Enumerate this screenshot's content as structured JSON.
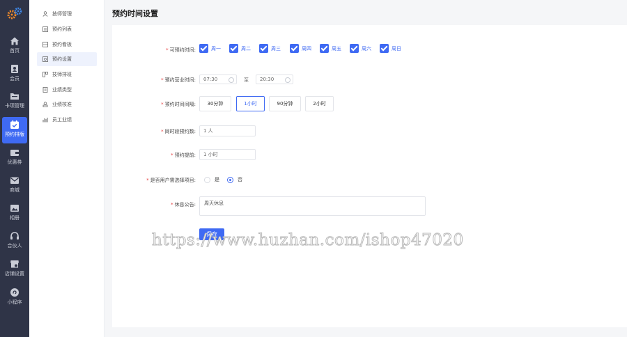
{
  "app": {
    "accent": "#3f6af3",
    "rail_bg": "#2f3447",
    "required_color": "#e63a3a"
  },
  "rail": {
    "items": [
      {
        "label": "首页",
        "icon": "home-icon"
      },
      {
        "label": "会员",
        "icon": "member-icon"
      },
      {
        "label": "卡项管理",
        "icon": "folder-icon"
      },
      {
        "label": "预约排版",
        "icon": "calendar-icon"
      },
      {
        "label": "优惠券",
        "icon": "wallet-icon"
      },
      {
        "label": "商城",
        "icon": "mail-icon"
      },
      {
        "label": "相册",
        "icon": "gallery-icon"
      },
      {
        "label": "合伙人",
        "icon": "headset-icon"
      },
      {
        "label": "店铺设置",
        "icon": "store-icon"
      },
      {
        "label": "小程序",
        "icon": "miniprogram-icon"
      }
    ],
    "active_index": 3
  },
  "submenu": {
    "items": [
      {
        "label": "技师管理",
        "icon": "user-icon"
      },
      {
        "label": "预约列表",
        "icon": "list-icon"
      },
      {
        "label": "预约看板",
        "icon": "board-icon"
      },
      {
        "label": "预约设置",
        "icon": "settings-icon"
      },
      {
        "label": "技师排班",
        "icon": "schedule-icon"
      },
      {
        "label": "业绩类型",
        "icon": "doc-icon"
      },
      {
        "label": "业绩核准",
        "icon": "approve-icon"
      },
      {
        "label": "员工业绩",
        "icon": "chart-icon"
      }
    ],
    "active_index": 3
  },
  "page": {
    "title": "预约时间设置"
  },
  "form": {
    "weekdays_label": "可预约时间:",
    "weekdays": [
      "周一",
      "周二",
      "周三",
      "周四",
      "周五",
      "周六",
      "周日"
    ],
    "hours_label": "预约营业时间:",
    "start_time": "07:30",
    "to_label": "至",
    "end_time": "20:30",
    "interval_label": "预约时间间隔:",
    "intervals": [
      "30分钟",
      "1小时",
      "90分钟",
      "2小时"
    ],
    "interval_selected": 1,
    "capacity_label": "同时段预约数:",
    "capacity_value": "1 人",
    "advance_label": "预约提前:",
    "advance_value": "1 小时",
    "mandatory_label": "是否用户需选择项目:",
    "mandatory_options": [
      "是",
      "否"
    ],
    "mandatory_selected": 1,
    "notice_label": "休息公告:",
    "notice_value": "周天休息",
    "save_label": "保存"
  },
  "watermark": "https://www.huzhan.com/ishop47020"
}
